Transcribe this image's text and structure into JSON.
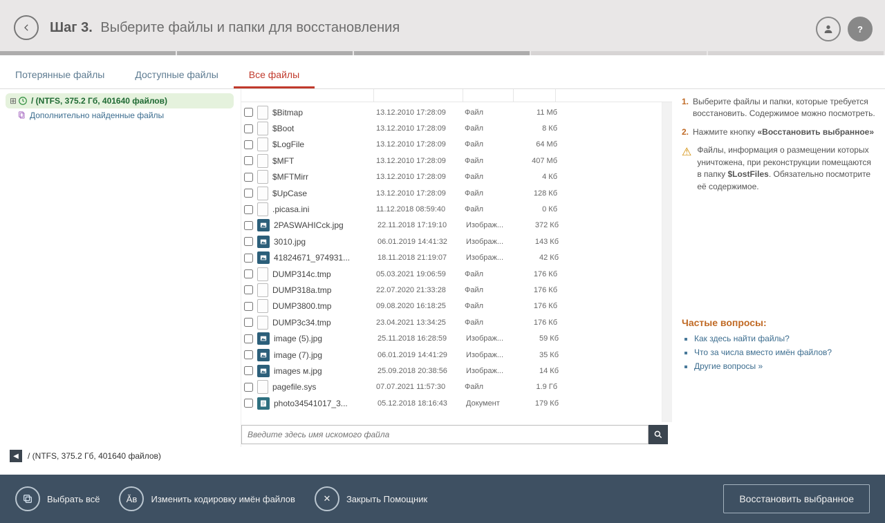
{
  "header": {
    "step_prefix": "Шаг 3.",
    "title_rest": "Выберите файлы и папки для восстановления"
  },
  "tabs": [
    {
      "label": "Потерянные файлы",
      "active": false
    },
    {
      "label": "Доступные файлы",
      "active": false
    },
    {
      "label": "Все файлы",
      "active": true
    }
  ],
  "tree": {
    "root_label": "/ (NTFS, 375.2 Гб, 401640 файлов)",
    "extra_label": "Дополнительно найденные файлы"
  },
  "files": [
    {
      "name": "$Bitmap",
      "date": "13.12.2010 17:28:09",
      "type": "Файл",
      "size": "11 Мб",
      "icon": "file"
    },
    {
      "name": "$Boot",
      "date": "13.12.2010 17:28:09",
      "type": "Файл",
      "size": "8 Кб",
      "icon": "file"
    },
    {
      "name": "$LogFile",
      "date": "13.12.2010 17:28:09",
      "type": "Файл",
      "size": "64 Мб",
      "icon": "file"
    },
    {
      "name": "$MFT",
      "date": "13.12.2010 17:28:09",
      "type": "Файл",
      "size": "407 Мб",
      "icon": "file"
    },
    {
      "name": "$MFTMirr",
      "date": "13.12.2010 17:28:09",
      "type": "Файл",
      "size": "4 Кб",
      "icon": "file"
    },
    {
      "name": "$UpCase",
      "date": "13.12.2010 17:28:09",
      "type": "Файл",
      "size": "128 Кб",
      "icon": "file"
    },
    {
      "name": ".picasa.ini",
      "date": "11.12.2018 08:59:40",
      "type": "Файл",
      "size": "0 Кб",
      "icon": "file"
    },
    {
      "name": "2PASWAHICck.jpg",
      "date": "22.11.2018 17:19:10",
      "type": "Изображ...",
      "size": "372 Кб",
      "icon": "img"
    },
    {
      "name": "3010.jpg",
      "date": "06.01.2019 14:41:32",
      "type": "Изображ...",
      "size": "143 Кб",
      "icon": "img"
    },
    {
      "name": "41824671_974931...",
      "date": "18.11.2018 21:19:07",
      "type": "Изображ...",
      "size": "42 Кб",
      "icon": "img"
    },
    {
      "name": "DUMP314c.tmp",
      "date": "05.03.2021 19:06:59",
      "type": "Файл",
      "size": "176 Кб",
      "icon": "file"
    },
    {
      "name": "DUMP318a.tmp",
      "date": "22.07.2020 21:33:28",
      "type": "Файл",
      "size": "176 Кб",
      "icon": "file"
    },
    {
      "name": "DUMP3800.tmp",
      "date": "09.08.2020 16:18:25",
      "type": "Файл",
      "size": "176 Кб",
      "icon": "file"
    },
    {
      "name": "DUMP3c34.tmp",
      "date": "23.04.2021 13:34:25",
      "type": "Файл",
      "size": "176 Кб",
      "icon": "file"
    },
    {
      "name": "image (5).jpg",
      "date": "25.11.2018 16:28:59",
      "type": "Изображ...",
      "size": "59 Кб",
      "icon": "img"
    },
    {
      "name": "image (7).jpg",
      "date": "06.01.2019 14:41:29",
      "type": "Изображ...",
      "size": "35 Кб",
      "icon": "img"
    },
    {
      "name": "images м.jpg",
      "date": "25.09.2018 20:38:56",
      "type": "Изображ...",
      "size": "14 Кб",
      "icon": "img"
    },
    {
      "name": "pagefile.sys",
      "date": "07.07.2021 11:57:30",
      "type": "Файл",
      "size": "1.9 Гб",
      "icon": "file"
    },
    {
      "name": "photo34541017_3...",
      "date": "05.12.2018 18:16:43",
      "type": "Документ",
      "size": "179 Кб",
      "icon": "doc"
    }
  ],
  "search": {
    "placeholder": "Введите здесь имя искомого файла"
  },
  "breadcrumb": {
    "path": "/ (NTFS, 375.2 Гб, 401640 файлов)"
  },
  "rpanel": {
    "step1_text": "Выберите файлы и папки, которые требуется восстановить. Содержимое можно посмотреть.",
    "step2_prefix": "Нажмите кнопку ",
    "step2_strong": "«Восстановить выбранное»",
    "warn_prefix": "Файлы, информация о размещении которых уничтожена, при реконструкции помещаются в папку ",
    "warn_strong": "$LostFiles",
    "warn_suffix": ". Обязательно посмотрите её содержимое.",
    "faq_title": "Частые вопросы:",
    "faq": [
      "Как здесь найти файлы?",
      "Что за числа вместо имён файлов?",
      "Другие вопросы »"
    ]
  },
  "footer": {
    "select_all": "Выбрать всё",
    "change_encoding": "Изменить кодировку имён файлов",
    "close_assistant": "Закрыть Помощник",
    "restore": "Восстановить выбранное"
  }
}
